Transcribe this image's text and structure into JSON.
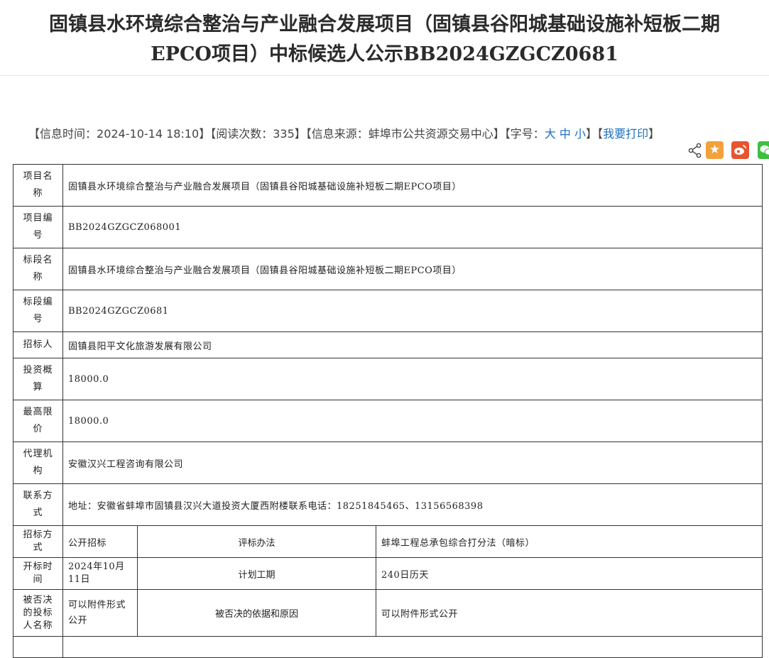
{
  "title": {
    "line1": "固镇县水环境综合整治与产业融合发展项目（固镇县谷阳城基础设施补短板二期",
    "line2": "EPCO项目）中标候选人公示BB2024GZGCZ0681"
  },
  "info": {
    "time_label": "【信息时间：",
    "time_value": "2024-10-14 18:10",
    "views_label": "】【阅读次数：",
    "views_value": "335",
    "source_label": "】【信息来源：",
    "source_value": "蚌埠市公共资源交易中心",
    "font_label": "】【字号：",
    "font_large": "大",
    "font_medium": "中",
    "font_small": "小",
    "print_open": "】【",
    "print_label": "我要打印",
    "print_close": "】"
  },
  "share": {
    "icons": [
      "share-icon",
      "favorite-star-icon",
      "weibo-icon",
      "wechat-icon"
    ],
    "colors": {
      "star": "#f2a23c",
      "weibo": "#e8542f",
      "wechat": "#3fbf3f"
    }
  },
  "table": {
    "project_name": {
      "label": "项目名称",
      "value": "固镇县水环境综合整治与产业融合发展项目（固镇县谷阳城基础设施补短板二期EPCO项目）"
    },
    "project_no": {
      "label": "项目编号",
      "value": "BB2024GZGCZ068001"
    },
    "section_name": {
      "label": "标段名称",
      "value": "固镇县水环境综合整治与产业融合发展项目（固镇县谷阳城基础设施补短板二期EPCO项目）"
    },
    "section_no": {
      "label": "标段编号",
      "value": "BB2024GZGCZ0681"
    },
    "tenderer": {
      "label": "招标人",
      "value": "固镇县阳平文化旅游发展有限公司"
    },
    "investment": {
      "label": "投资概算",
      "value": "18000.0"
    },
    "max_price": {
      "label": "最高限价",
      "value": "18000.0"
    },
    "agency": {
      "label": "代理机构",
      "value": "安徽汉兴工程咨询有限公司"
    },
    "contact": {
      "label": "联系方式",
      "value": "地址：安徽省蚌埠市固镇县汉兴大道投资大厦西附楼联系电话：18251845465、13156568398"
    },
    "method": {
      "label": "招标方式",
      "value": "公开招标",
      "label2": "评标办法",
      "value2": "蚌埠工程总承包综合打分法（暗标）"
    },
    "open_time": {
      "label": "开标时间",
      "value": "2024年10月11日",
      "label2": "计划工期",
      "value2": "240日历天"
    },
    "rejected": {
      "label": "被否决的投标人名称",
      "value": "可以附件形式公开",
      "label2": "被否决的依据和原因",
      "value2": "可以附件形式公开"
    }
  }
}
